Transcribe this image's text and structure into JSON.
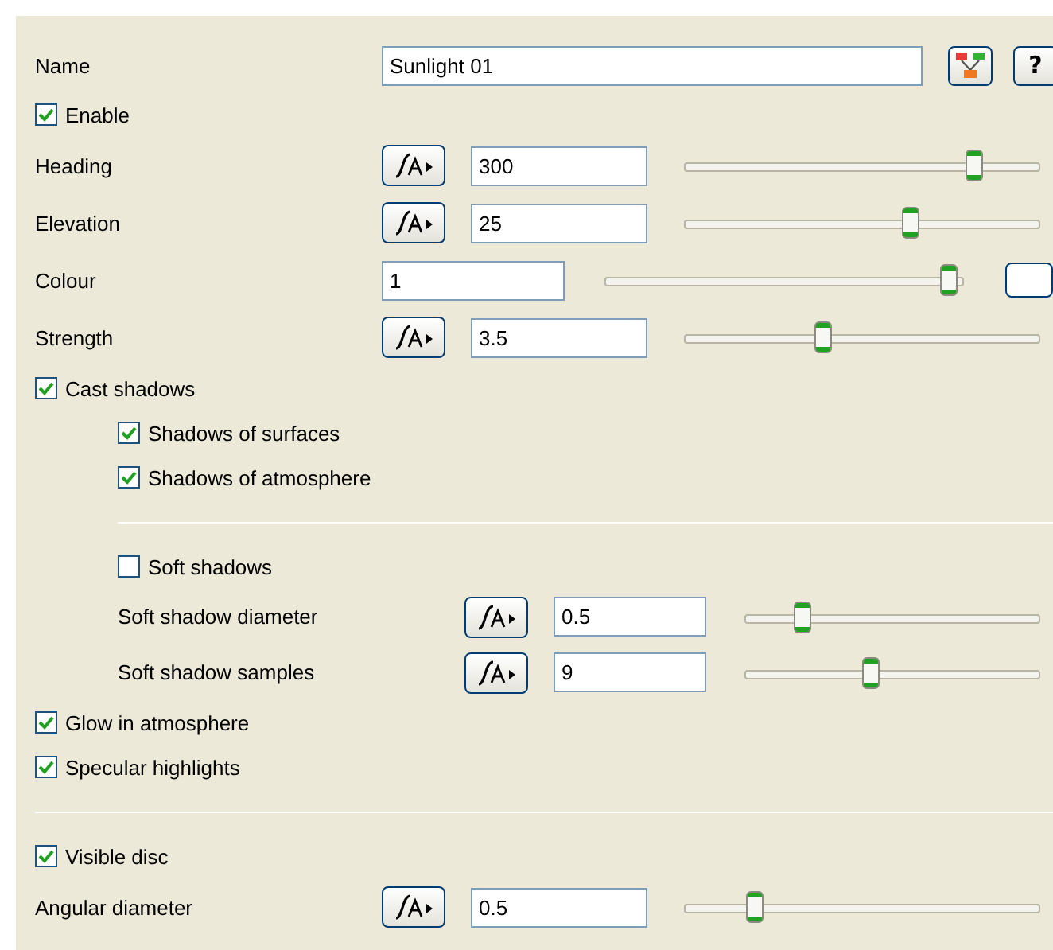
{
  "name": {
    "label": "Name",
    "value": "Sunlight 01",
    "help": "?"
  },
  "rows": [
    {
      "kind": "checkbox",
      "label": "Enable",
      "checked": true
    },
    {
      "kind": "param",
      "label": "Heading",
      "value": "300",
      "level": 0.83
    },
    {
      "kind": "param",
      "label": "Elevation",
      "value": "25",
      "level": 0.64
    },
    {
      "kind": "colour",
      "label": "Colour",
      "value": "1",
      "level": 0.98
    },
    {
      "kind": "param",
      "label": "Strength",
      "value": "3.5",
      "level": 0.38
    },
    {
      "kind": "checkbox",
      "label": "Cast shadows",
      "checked": true,
      "children": [
        {
          "kind": "checkbox",
          "label": "Shadows of surfaces",
          "checked": true
        },
        {
          "kind": "checkbox",
          "label": "Shadows of atmosphere",
          "checked": true
        },
        {
          "kind": "divider"
        },
        {
          "kind": "checkbox",
          "label": "Soft shadows",
          "checked": false
        },
        {
          "kind": "param",
          "label": "Soft shadow diameter",
          "value": "0.5",
          "level": 0.17
        },
        {
          "kind": "param",
          "label": "Soft shadow samples",
          "value": "9",
          "level": 0.42
        }
      ]
    },
    {
      "kind": "checkbox",
      "label": "Glow in atmosphere",
      "checked": true
    },
    {
      "kind": "checkbox",
      "label": "Specular highlights",
      "checked": true
    },
    {
      "kind": "divider"
    },
    {
      "kind": "checkbox",
      "label": "Visible disc",
      "checked": true
    },
    {
      "kind": "param",
      "label": "Angular diameter",
      "value": "0.5",
      "level": 0.18
    }
  ]
}
